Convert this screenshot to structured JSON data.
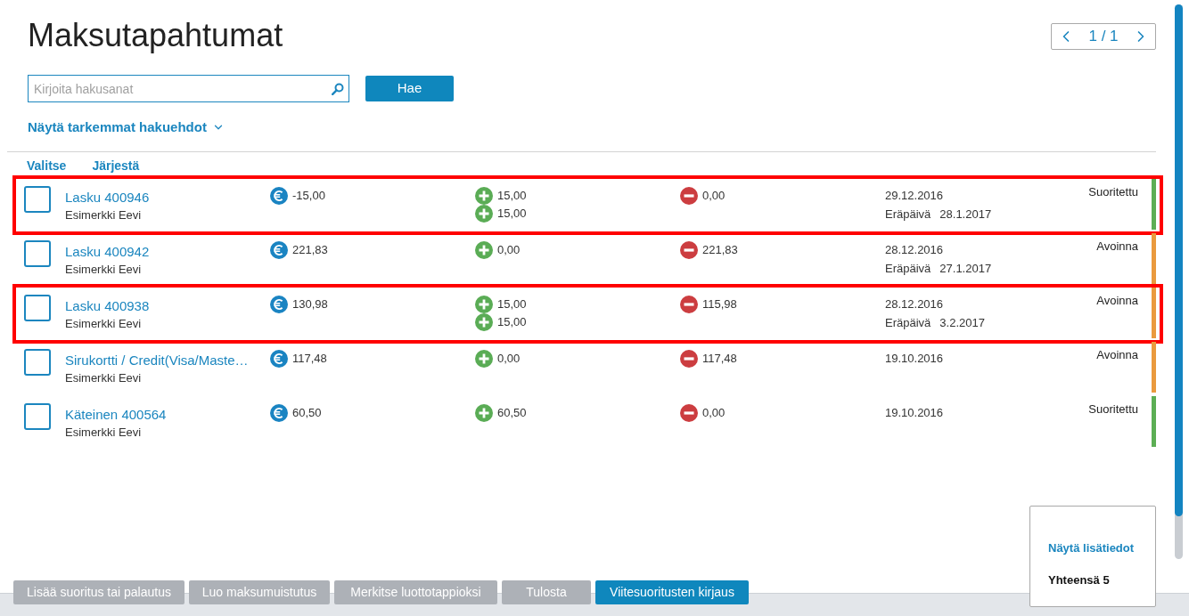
{
  "title": "Maksutapahtumat",
  "pager": {
    "label": "1 / 1"
  },
  "search": {
    "placeholder": "Kirjoita hakusanat",
    "button": "Hae"
  },
  "advanced_link": "Näytä tarkemmat hakuehdot",
  "list_actions": [
    "Valitse",
    "Järjestä"
  ],
  "rows": [
    {
      "checked": false,
      "highlighted": true,
      "name": "Lasku 400946",
      "customer": "Esimerkki Eevi",
      "amount": "-15,00",
      "payments": [
        "15,00",
        "15,00"
      ],
      "outstanding": "0,00",
      "date": "29.12.2016",
      "due_label": "Eräpäivä",
      "due_date": "28.1.2017",
      "status": "Suoritettu",
      "color": "#5cae54"
    },
    {
      "checked": false,
      "highlighted": false,
      "name": "Lasku 400942",
      "customer": "Esimerkki Eevi",
      "amount": "221,83",
      "payments": [
        "0,00"
      ],
      "outstanding": "221,83",
      "date": "28.12.2016",
      "due_label": "Eräpäivä",
      "due_date": "27.1.2017",
      "status": "Avoinna",
      "color": "#ea9a3e"
    },
    {
      "checked": false,
      "highlighted": true,
      "name": "Lasku 400938",
      "customer": "Esimerkki Eevi",
      "amount": "130,98",
      "payments": [
        "15,00",
        "15,00"
      ],
      "outstanding": "115,98",
      "date": "28.12.2016",
      "due_label": "Eräpäivä",
      "due_date": "3.2.2017",
      "status": "Avoinna",
      "color": "#ea9a3e"
    },
    {
      "checked": false,
      "highlighted": false,
      "name": "Sirukortti / Credit(Visa/Maste…",
      "customer": "Esimerkki Eevi",
      "amount": "117,48",
      "payments": [
        "0,00"
      ],
      "outstanding": "117,48",
      "date": "19.10.2016",
      "status": "Avoinna",
      "color": "#ea9a3e"
    },
    {
      "checked": false,
      "highlighted": false,
      "name": "Käteinen 400564",
      "customer": "Esimerkki Eevi",
      "amount": "60,50",
      "payments": [
        "60,50"
      ],
      "outstanding": "0,00",
      "date": "19.10.2016",
      "status": "Suoritettu",
      "color": "#5cae54"
    }
  ],
  "summary": {
    "link": "Näytä lisätiedot",
    "total": "Yhteensä 5"
  },
  "footer_buttons": [
    {
      "label": "Lisää suoritus tai palautus",
      "disabled": true
    },
    {
      "label": "Luo maksumuistutus",
      "disabled": true
    },
    {
      "label": "Merkitse luottotappioksi",
      "disabled": true
    },
    {
      "label": "Tulosta",
      "disabled": true
    },
    {
      "label": "Viitesuoritusten kirjaus",
      "disabled": false
    }
  ]
}
